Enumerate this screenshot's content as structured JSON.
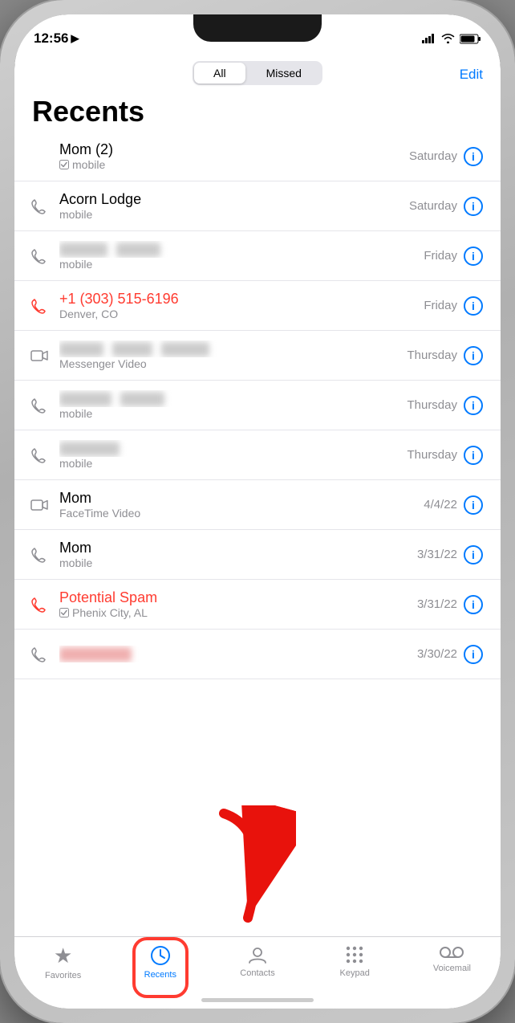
{
  "statusBar": {
    "time": "12:56",
    "locationIcon": "▶"
  },
  "segmentedControl": {
    "tabs": [
      "All",
      "Missed"
    ],
    "activeTab": "All",
    "editLabel": "Edit"
  },
  "pageTitle": "Recents",
  "calls": [
    {
      "id": 1,
      "name": "Mom (2)",
      "sub": "mobile",
      "date": "Saturday",
      "type": "incoming",
      "missed": false,
      "blurred": false,
      "hasCheckmark": true,
      "callIcon": "phone"
    },
    {
      "id": 2,
      "name": "Acorn Lodge",
      "sub": "mobile",
      "date": "Saturday",
      "type": "incoming",
      "missed": false,
      "blurred": false,
      "callIcon": "phone"
    },
    {
      "id": 3,
      "name": "",
      "sub": "mobile",
      "date": "Friday",
      "type": "incoming",
      "missed": false,
      "blurred": true,
      "blurredWidth": 120,
      "callIcon": "phone"
    },
    {
      "id": 4,
      "name": "+1 (303) 515-6196",
      "sub": "Denver, CO",
      "date": "Friday",
      "type": "missed",
      "missed": true,
      "blurred": false,
      "callIcon": "phone"
    },
    {
      "id": 5,
      "name": "",
      "sub": "Messenger Video",
      "date": "Thursday",
      "type": "incoming",
      "missed": false,
      "blurred": true,
      "blurredWidth": 180,
      "callIcon": "video"
    },
    {
      "id": 6,
      "name": "",
      "sub": "mobile",
      "date": "Thursday",
      "type": "incoming",
      "missed": false,
      "blurred": true,
      "blurredWidth": 130,
      "callIcon": "phone"
    },
    {
      "id": 7,
      "name": "",
      "sub": "mobile",
      "date": "Thursday",
      "type": "incoming",
      "missed": false,
      "blurred": true,
      "blurredWidth": 80,
      "callIcon": "phone"
    },
    {
      "id": 8,
      "name": "Mom",
      "sub": "FaceTime Video",
      "date": "4/4/22",
      "type": "incoming",
      "missed": false,
      "blurred": false,
      "callIcon": "video"
    },
    {
      "id": 9,
      "name": "Mom",
      "sub": "mobile",
      "date": "3/31/22",
      "type": "incoming",
      "missed": false,
      "blurred": false,
      "callIcon": "phone"
    },
    {
      "id": 10,
      "name": "Potential Spam",
      "sub": "Phenix City, AL",
      "date": "3/31/22",
      "type": "missed",
      "missed": true,
      "blurred": false,
      "hasCheckmark": true,
      "callIcon": "phone"
    },
    {
      "id": 11,
      "name": "",
      "sub": "",
      "date": "3/30/22",
      "type": "incoming",
      "missed": false,
      "blurred": true,
      "blurredWidth": 100,
      "callIcon": "phone"
    }
  ],
  "tabBar": {
    "items": [
      {
        "id": "favorites",
        "icon": "★",
        "label": "Favorites",
        "active": false
      },
      {
        "id": "recents",
        "icon": "🕐",
        "label": "Recents",
        "active": true
      },
      {
        "id": "contacts",
        "icon": "👤",
        "label": "Contacts",
        "active": false
      },
      {
        "id": "keypad",
        "icon": "⠿",
        "label": "Keypad",
        "active": false
      },
      {
        "id": "voicemail",
        "icon": "⊙",
        "label": "Voicemail",
        "active": false
      }
    ]
  }
}
